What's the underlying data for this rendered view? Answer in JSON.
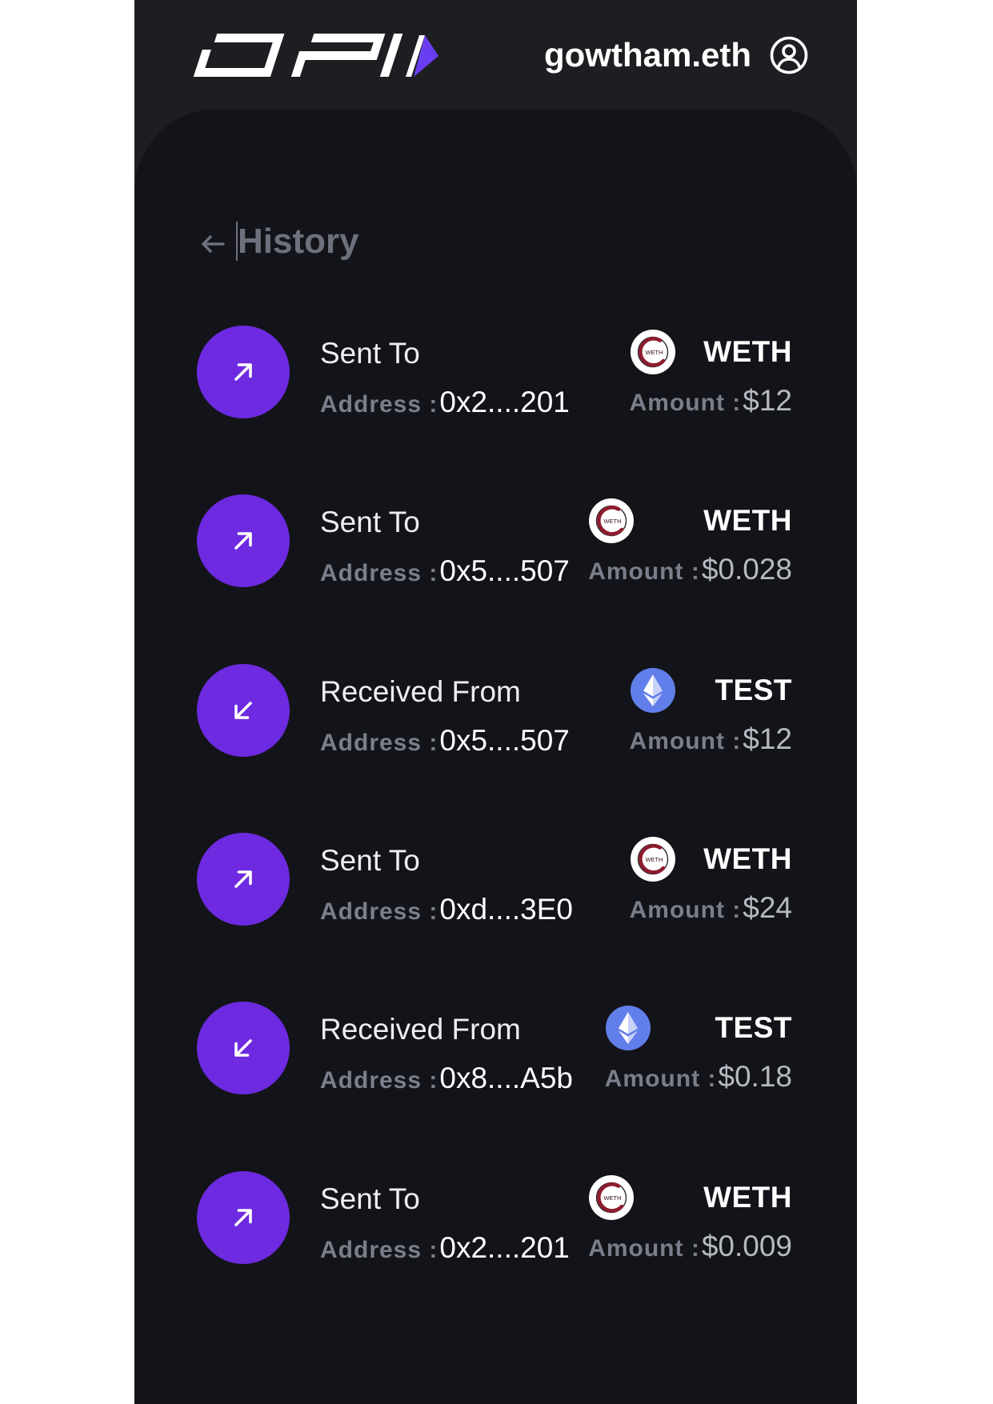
{
  "header": {
    "logo": "DPI",
    "username": "gowtham.eth",
    "user_icon": "user-circle-icon"
  },
  "page": {
    "back_icon": "arrow-left-icon",
    "title": "History"
  },
  "labels": {
    "address": "Address :",
    "amount": "Amount :"
  },
  "colors": {
    "header_bg": "#1d1e22",
    "body_bg": "#131419",
    "accent": "#6d2ae0",
    "muted_text": "#7b7e8a",
    "amount_text": "#b7b9c1",
    "eth_blue": "#627eea",
    "weth_red": "#8e1c2e"
  },
  "transactions": [
    {
      "direction_icon": "arrow-up-right-icon",
      "title": "Sent To",
      "address": "0x2....201",
      "token_icon": "weth-icon",
      "token_icon_text": "WETH",
      "token": "WETH",
      "amount": "$12"
    },
    {
      "direction_icon": "arrow-up-right-icon",
      "title": "Sent To",
      "address": "0x5....507",
      "token_icon": "weth-icon",
      "token_icon_text": "WETH",
      "token": "WETH",
      "amount": "$0.028"
    },
    {
      "direction_icon": "arrow-down-left-icon",
      "title": "Received From",
      "address": "0x5....507",
      "token_icon": "eth-icon",
      "token": "TEST",
      "amount": "$12"
    },
    {
      "direction_icon": "arrow-up-right-icon",
      "title": "Sent To",
      "address": "0xd....3E0",
      "token_icon": "weth-icon",
      "token_icon_text": "WETH",
      "token": "WETH",
      "amount": "$24"
    },
    {
      "direction_icon": "arrow-down-left-icon",
      "title": "Received From",
      "address": "0x8....A5b",
      "token_icon": "eth-icon",
      "token": "TEST",
      "amount": "$0.18"
    },
    {
      "direction_icon": "arrow-up-right-icon",
      "title": "Sent To",
      "address": "0x2....201",
      "token_icon": "weth-icon",
      "token_icon_text": "WETH",
      "token": "WETH",
      "amount": "$0.009"
    }
  ]
}
